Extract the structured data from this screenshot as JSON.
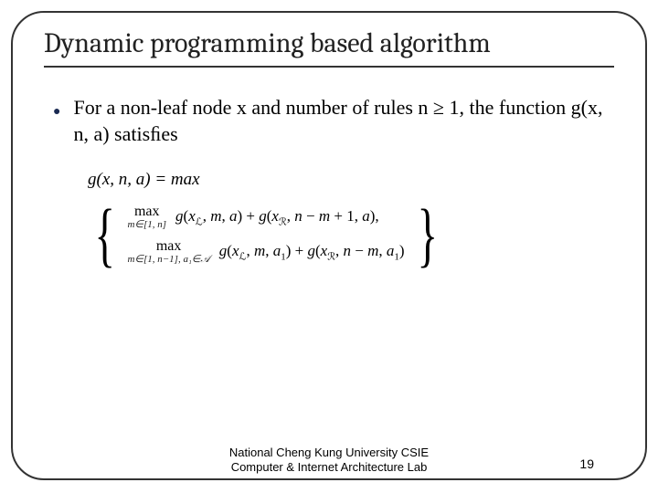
{
  "title": "Dynamic programming based algorithm",
  "bullet_text": "For a non-leaf node x and number of rules n ≥ 1, the function g(x, n, a) satisﬁes",
  "eq_head": "g(x, n, a) = max",
  "case1": {
    "max_label": "max",
    "max_domain": "m∈[1, n]",
    "expr": "g(xᴃ, m, a) + g(xᴿ, n − m + 1, a),"
  },
  "case2": {
    "max_label": "max",
    "max_domain": "m∈[1, n−1], a₁∈𝒜",
    "expr": "g(xᴃ, m, a₁) + g(xᴿ, n − m, a₁)"
  },
  "footer_line1": "National Cheng Kung University CSIE",
  "footer_line2": "Computer & Internet Architecture Lab",
  "page_number": "19"
}
